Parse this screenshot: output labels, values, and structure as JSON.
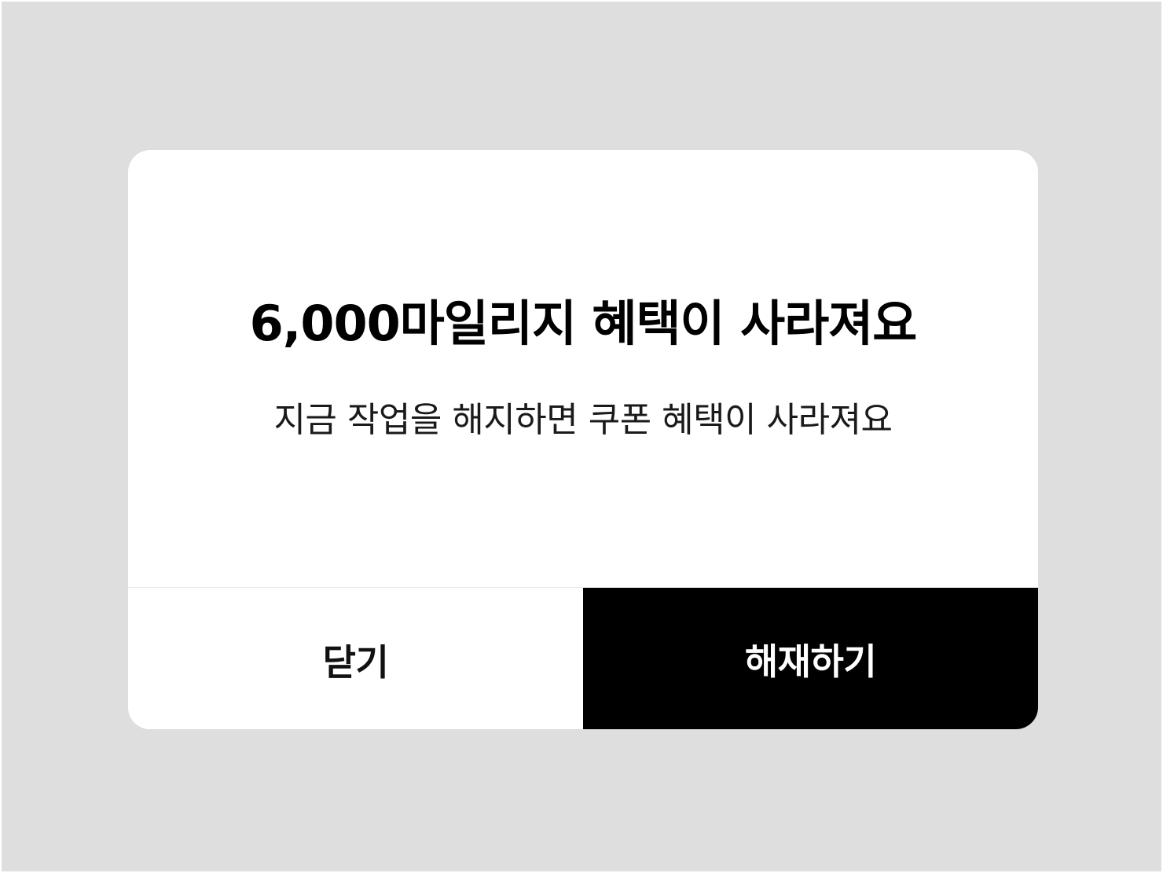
{
  "colors": {
    "backdrop": "#dedede",
    "dialog_background": "#ffffff",
    "title_text": "#000000",
    "message_text": "#1a1a1a",
    "divider": "#e6e6e6",
    "close_button_background": "#ffffff",
    "close_button_text": "#111111",
    "primary_button_background": "#000000",
    "primary_button_text": "#ffffff"
  },
  "dialog": {
    "title": "6,000마일리지 혜택이 사라져요",
    "message": "지금 작업을 해지하면 쿠폰 혜택이 사라져요",
    "buttons": {
      "close_label": "닫기",
      "primary_label": "해재하기"
    }
  }
}
